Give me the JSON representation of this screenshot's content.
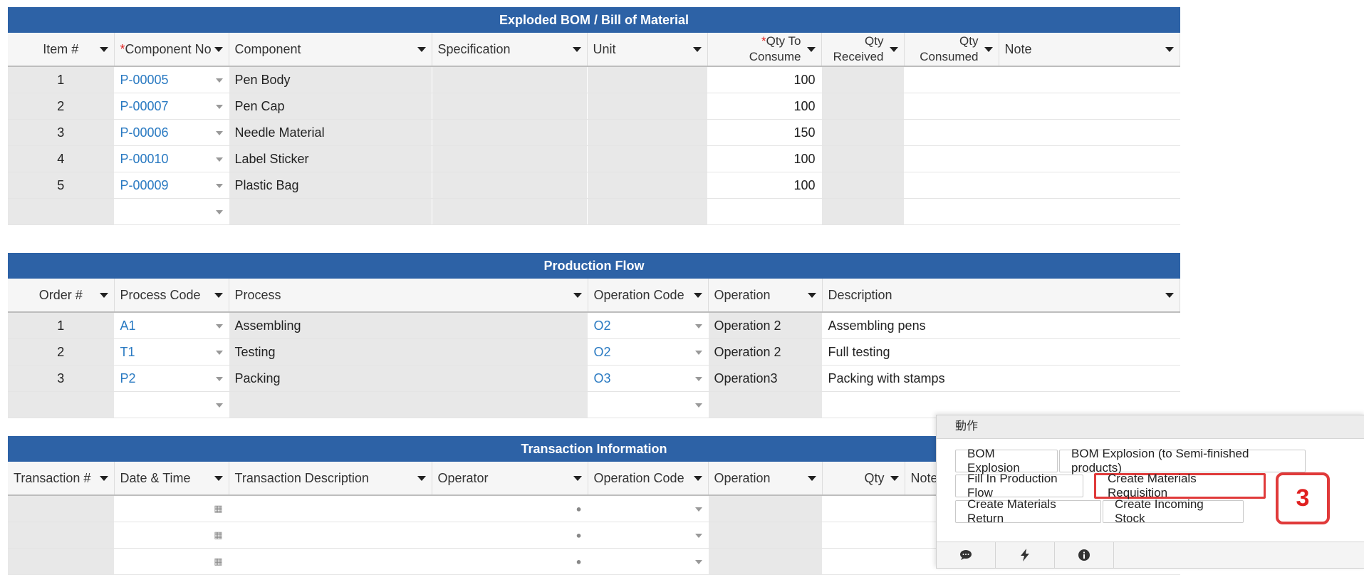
{
  "bom": {
    "title": "Exploded BOM / Bill of Material",
    "headers": {
      "item": "Item #",
      "component_no_req": "*",
      "component_no": "Component No",
      "component": "Component",
      "specification": "Specification",
      "unit": "Unit",
      "qty_to_consume_req": "*",
      "qty_to_consume_l1": "Qty To",
      "qty_to_consume_l2": "Consume",
      "qty_received_l1": "Qty",
      "qty_received_l2": "Received",
      "qty_consumed_l1": "Qty",
      "qty_consumed_l2": "Consumed",
      "note": "Note"
    },
    "rows": [
      {
        "item": "1",
        "component_no": "P-00005",
        "component": "Pen Body",
        "qty": "100"
      },
      {
        "item": "2",
        "component_no": "P-00007",
        "component": "Pen Cap",
        "qty": "100"
      },
      {
        "item": "3",
        "component_no": "P-00006",
        "component": "Needle Material",
        "qty": "150"
      },
      {
        "item": "4",
        "component_no": "P-00010",
        "component": "Label Sticker",
        "qty": "100"
      },
      {
        "item": "5",
        "component_no": "P-00009",
        "component": "Plastic Bag",
        "qty": "100"
      }
    ]
  },
  "flow": {
    "title": "Production Flow",
    "headers": {
      "order": "Order #",
      "process_code": "Process Code",
      "process": "Process",
      "operation_code": "Operation Code",
      "operation": "Operation",
      "description": "Description"
    },
    "rows": [
      {
        "order": "1",
        "process_code": "A1",
        "process": "Assembling",
        "operation_code": "O2",
        "operation": "Operation 2",
        "description": "Assembling pens"
      },
      {
        "order": "2",
        "process_code": "T1",
        "process": "Testing",
        "operation_code": "O2",
        "operation": "Operation 2",
        "description": "Full testing"
      },
      {
        "order": "3",
        "process_code": "P2",
        "process": "Packing",
        "operation_code": "O3",
        "operation": "Operation3",
        "description": "Packing with stamps"
      }
    ]
  },
  "transactions": {
    "title": "Transaction Information",
    "headers": {
      "transaction": "Transaction #",
      "date_time": "Date & Time",
      "description": "Transaction Description",
      "operator": "Operator",
      "operation_code": "Operation Code",
      "operation": "Operation",
      "qty": "Qty",
      "note": "Note"
    }
  },
  "actions": {
    "title": "動作",
    "buttons": {
      "bom_explosion": "BOM Explosion",
      "bom_explosion_semi": "BOM Explosion (to Semi-finished products)",
      "fill_flow": "Fill In Production Flow",
      "create_requisition": "Create Materials Requisition",
      "create_return": "Create Materials Return",
      "create_incoming": "Create Incoming Stock"
    },
    "step_badge": "3",
    "footer_icons": [
      "comment-icon",
      "lightning-icon",
      "info-icon"
    ]
  },
  "colors": {
    "header_blue": "#2d62a6",
    "link_blue": "#2a7ac2",
    "highlight_red": "#e03a3a",
    "required_red": "#e0201e"
  }
}
